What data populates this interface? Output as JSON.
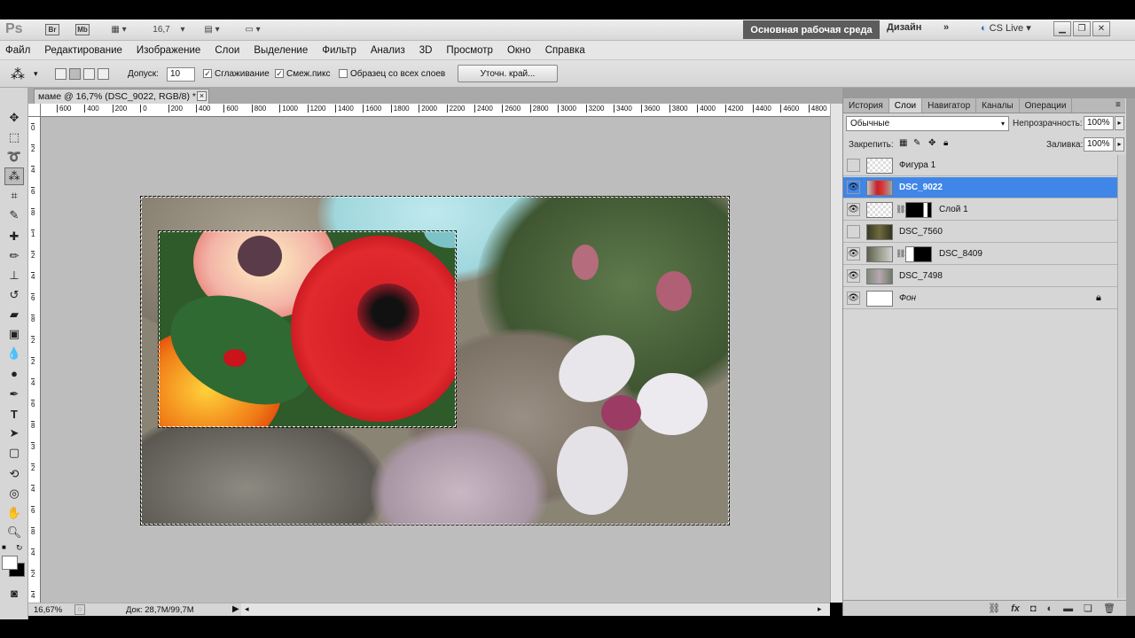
{
  "app": {
    "logo": "Ps",
    "br_chip": "Br",
    "mb_chip": "Mb",
    "zoom_value": "16,7",
    "workspace_label": "Основная рабочая среда",
    "design_label": "Дизайн",
    "more_label": "»",
    "cs_live_label": "CS Live"
  },
  "menu": [
    "Файл",
    "Редактирование",
    "Изображение",
    "Слои",
    "Выделение",
    "Фильтр",
    "Анализ",
    "3D",
    "Просмотр",
    "Окно",
    "Справка"
  ],
  "options": {
    "tolerance_label": "Допуск:",
    "tolerance_value": "10",
    "antialias_label": "Сглаживание",
    "antialias_checked": "✓",
    "contiguous_label": "Смеж.пикс",
    "contiguous_checked": "✓",
    "sample_all_label": "Образец со всех слоев",
    "refine_edge_label": "Уточн. край..."
  },
  "document": {
    "tab_title": "маме @ 16,7% (DSC_9022, RGB/8) *",
    "close_glyph": "×",
    "zoom_status": "16,67%",
    "doc_info": "Док: 28,7M/99,7M"
  },
  "ruler_h": [
    "600",
    "400",
    "200",
    "0",
    "200",
    "400",
    "600",
    "800",
    "1000",
    "1200",
    "1400",
    "1600",
    "1800",
    "2000",
    "2200",
    "2400",
    "2600",
    "2800",
    "3000",
    "3200",
    "3400",
    "3600",
    "3800",
    "4000",
    "4200",
    "4400",
    "4600",
    "4800"
  ],
  "ruler_v": [
    "0",
    "2",
    "4",
    "6",
    "8",
    "1",
    "2",
    "4",
    "6",
    "8",
    "2",
    "2",
    "4",
    "6",
    "8",
    "3",
    "2",
    "4",
    "6",
    "8",
    "4",
    "2",
    "4"
  ],
  "panel": {
    "tabs": [
      "История",
      "Слои",
      "Навигатор",
      "Каналы",
      "Операции"
    ],
    "active_tab": "Слои",
    "blend_mode": "Обычные",
    "opacity_label": "Непрозрачность:",
    "opacity_value": "100%",
    "lock_label": "Закрепить:",
    "fill_label": "Заливка:",
    "fill_value": "100%"
  },
  "layers": [
    {
      "name": "Фигура 1",
      "visible": false,
      "selected": false,
      "mask": false,
      "italic": false,
      "locked": false
    },
    {
      "name": "DSC_9022",
      "visible": true,
      "selected": true,
      "mask": false,
      "italic": false,
      "locked": false
    },
    {
      "name": "Слой 1",
      "visible": true,
      "selected": false,
      "mask": true,
      "italic": false,
      "locked": false
    },
    {
      "name": "DSC_7560",
      "visible": false,
      "selected": false,
      "mask": false,
      "italic": false,
      "locked": false
    },
    {
      "name": "DSC_8409",
      "visible": true,
      "selected": false,
      "mask": true,
      "italic": false,
      "locked": false
    },
    {
      "name": "DSC_7498",
      "visible": true,
      "selected": false,
      "mask": false,
      "italic": false,
      "locked": false
    },
    {
      "name": "Фон",
      "visible": true,
      "selected": false,
      "mask": false,
      "italic": true,
      "locked": true
    }
  ],
  "colors": {
    "selected_layer": "#3f86e8",
    "workspace_btn": "#5c5c5c",
    "pasteboard": "#bdbdbd"
  }
}
